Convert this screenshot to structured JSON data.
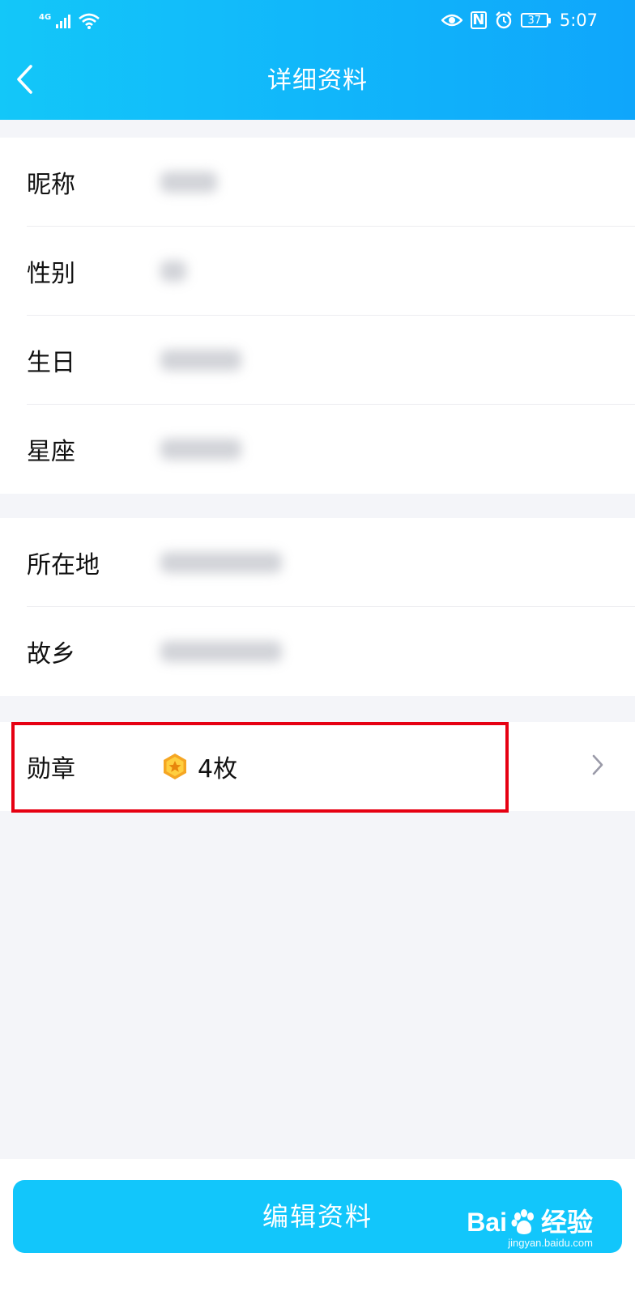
{
  "status_bar": {
    "network": "4G",
    "battery": "37",
    "time": "5:07"
  },
  "header": {
    "title": "详细资料"
  },
  "profile": {
    "group1": [
      {
        "label": "昵称",
        "value": ""
      },
      {
        "label": "性别",
        "value": ""
      },
      {
        "label": "生日",
        "value": ""
      },
      {
        "label": "星座",
        "value": ""
      }
    ],
    "group2": [
      {
        "label": "所在地",
        "value": ""
      },
      {
        "label": "故乡",
        "value": ""
      }
    ],
    "badge": {
      "label": "勋章",
      "count": "4枚"
    }
  },
  "footer": {
    "edit_label": "编辑资料"
  },
  "watermark": {
    "brand_left": "Bai",
    "brand_right": "经验",
    "url": "jingyan.baidu.com"
  },
  "colors": {
    "header_start": "#13c7f9",
    "header_end": "#0fa6fb",
    "button": "#12c6fb",
    "highlight": "#e60012",
    "badge_gold": "#f5a623"
  }
}
